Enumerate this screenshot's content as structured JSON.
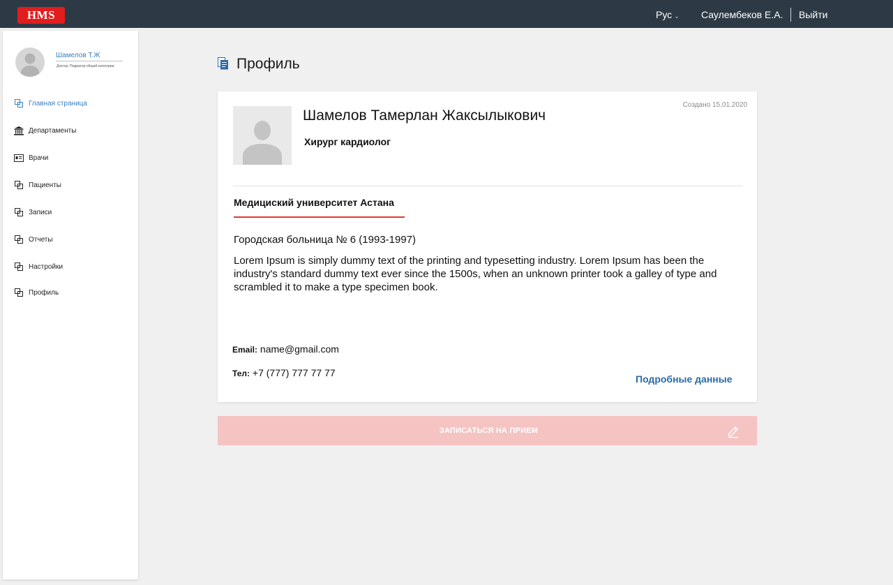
{
  "header": {
    "logo_text": "HMS",
    "language": "Рус",
    "user_name": "Саулембеков Е.А.",
    "logout_label": "Выйти"
  },
  "sidebar": {
    "user_name": "Шамелов Т.Ж",
    "user_role": "Доктор, Педиатор общей категории",
    "items": [
      {
        "label": "Главная страница",
        "icon": "pages-icon",
        "active": true
      },
      {
        "label": "Департаменты",
        "icon": "building-icon",
        "active": false
      },
      {
        "label": "Врачи",
        "icon": "id-card-icon",
        "active": false
      },
      {
        "label": "Пациенты",
        "icon": "pages-icon",
        "active": false
      },
      {
        "label": "Записи",
        "icon": "pages-icon",
        "active": false
      },
      {
        "label": "Отчеты",
        "icon": "pages-icon",
        "active": false
      },
      {
        "label": "Настройки",
        "icon": "pages-icon",
        "active": false
      },
      {
        "label": "Профиль",
        "icon": "pages-icon",
        "active": false
      }
    ]
  },
  "page": {
    "title": "Профиль"
  },
  "profile": {
    "created": "Создано 15.01.2020",
    "full_name": "Шамелов Тамерлан Жаксылыкович",
    "position": "Хирург кардиолог",
    "university": "Медициский университет Астана",
    "workplace": "Городская больница  № 6 (1993-1997)",
    "description": "Lorem Ipsum is simply dummy text of the printing and typesetting industry. Lorem Ipsum has been the industry's standard dummy text ever since the 1500s, when an unknown printer took a galley of type and scrambled it to make a type specimen book.",
    "email_label": "Email:",
    "email": "name@gmail.com",
    "phone_label": "Тел:",
    "phone": "+7 (777) 777 77 77",
    "details_link": "Подробные данные"
  },
  "appointment": {
    "label": "ЗАПИСАТЬСЯ НА ПРИЕМ"
  },
  "colors": {
    "topbar": "#2d3a46",
    "brand_red": "#e21d1d",
    "link_blue": "#2c6aa6",
    "accent_red": "#e2382e",
    "button_pink": "#f6c3c3"
  }
}
